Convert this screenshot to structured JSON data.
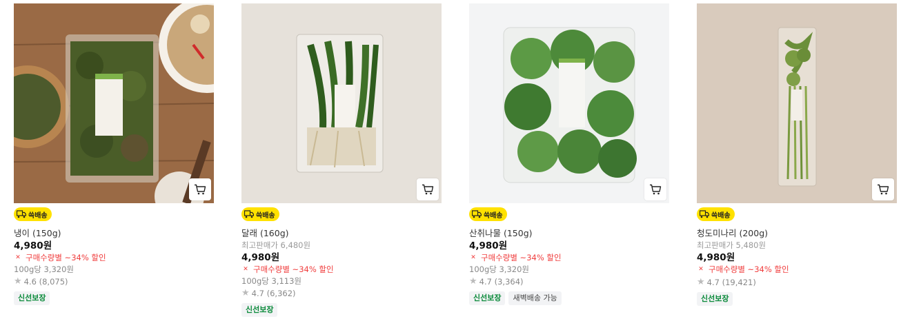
{
  "icons": {
    "cart": "cart-icon",
    "delivery": "truck-icon",
    "discount": "discount-icon",
    "star": "star-icon"
  },
  "colors": {
    "badge": "#ffe100",
    "discount": "#f03e3e",
    "fresh_tag": "#0a8a3a"
  },
  "products": [
    {
      "name": "냉이 (150g)",
      "delivery_badge": "쓱배송",
      "price": "4,980원",
      "discount": "구매수량별 ~34% 할인",
      "unit_price": "100g당 3,320원",
      "rating": "4.6",
      "reviews": "(8,075)",
      "tags": [
        "신선보장"
      ]
    },
    {
      "name": "달래 (160g)",
      "delivery_badge": "쓱배송",
      "original_price": "최고판매가 6,480원",
      "price": "4,980원",
      "discount": "구매수량별 ~34% 할인",
      "unit_price": "100g당 3,113원",
      "rating": "4.7",
      "reviews": "(6,362)",
      "tags": [
        "신선보장"
      ]
    },
    {
      "name": "산취나물 (150g)",
      "delivery_badge": "쓱배송",
      "price": "4,980원",
      "discount": "구매수량별 ~34% 할인",
      "unit_price": "100g당 3,320원",
      "rating": "4.7",
      "reviews": "(3,364)",
      "tags": [
        "신선보장",
        "새벽배송 가능"
      ]
    },
    {
      "name": "청도미나리 (200g)",
      "delivery_badge": "쓱배송",
      "original_price": "최고판매가 5,480원",
      "price": "4,980원",
      "discount": "구매수량별 ~34% 할인",
      "rating": "4.7",
      "reviews": "(19,421)",
      "tags": [
        "신선보장"
      ]
    }
  ]
}
